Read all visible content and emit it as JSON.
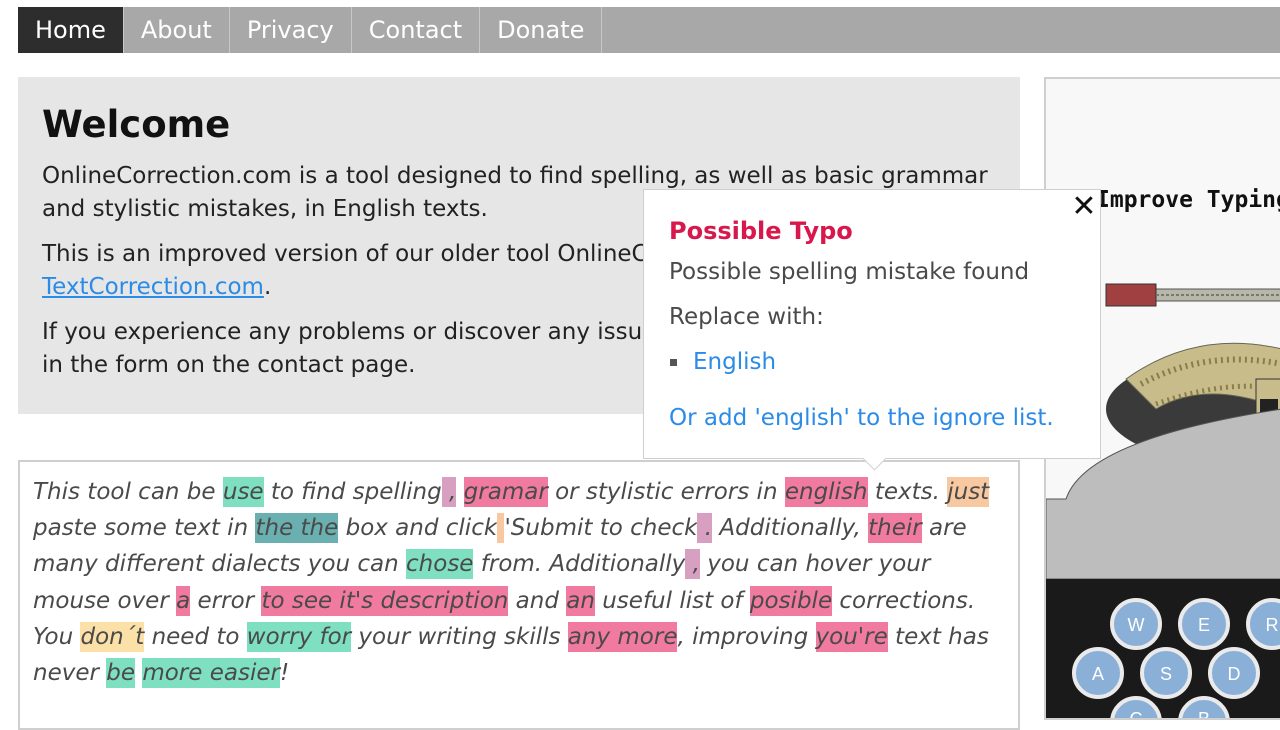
{
  "nav": {
    "items": [
      {
        "label": "Home",
        "active": true
      },
      {
        "label": "About"
      },
      {
        "label": "Privacy"
      },
      {
        "label": "Contact"
      },
      {
        "label": "Donate"
      }
    ]
  },
  "welcome": {
    "title": "Welcome",
    "p1": "OnlineCorrection.com is a tool designed to find spelling, as well as basic grammar and stylistic mistakes, in English texts.",
    "p2_before": "This is an improved version of our older tool OnlineCorrection, still available at ",
    "p2_link": "TextCorrection.com",
    "p2_after": ".",
    "p3": "If you experience any problems or discover any issues please let us know by filling in the form on the contact page."
  },
  "editor": {
    "segments": [
      {
        "t": "This tool can be "
      },
      {
        "t": "use",
        "c": "green"
      },
      {
        "t": " to find spelling"
      },
      {
        "t": " ,",
        "c": "mauve"
      },
      {
        "t": " "
      },
      {
        "t": "gramar",
        "c": "pink"
      },
      {
        "t": " or stylistic errors in "
      },
      {
        "t": "english",
        "c": "pink"
      },
      {
        "t": " texts. "
      },
      {
        "t": "just",
        "c": "orange"
      },
      {
        "t": " paste some text in "
      },
      {
        "t": "the the",
        "c": "teal"
      },
      {
        "t": " box and click"
      },
      {
        "t": " ",
        "c": "orange"
      },
      {
        "t": "'Submit to check"
      },
      {
        "t": " .",
        "c": "mauve"
      },
      {
        "t": " Additionally, "
      },
      {
        "t": "their",
        "c": "pink"
      },
      {
        "t": " are many different dialects you can "
      },
      {
        "t": "chose",
        "c": "green"
      },
      {
        "t": " from. Additionally"
      },
      {
        "t": " ,",
        "c": "mauve"
      },
      {
        "t": " you can hover your mouse over "
      },
      {
        "t": "a",
        "c": "pink"
      },
      {
        "t": " error "
      },
      {
        "t": "to see it's description",
        "c": "pink"
      },
      {
        "t": " and "
      },
      {
        "t": "an",
        "c": "pink"
      },
      {
        "t": " useful list of "
      },
      {
        "t": "posible",
        "c": "pink"
      },
      {
        "t": " corrections. You "
      },
      {
        "t": "don´t",
        "c": "yellow"
      },
      {
        "t": " need to "
      },
      {
        "t": "worry for",
        "c": "green"
      },
      {
        "t": " your writing skills "
      },
      {
        "t": "any more",
        "c": "pink"
      },
      {
        "t": ", improving "
      },
      {
        "t": "you're",
        "c": "pink"
      },
      {
        "t": " text has never "
      },
      {
        "t": "be",
        "c": "green"
      },
      {
        "t": " "
      },
      {
        "t": "more easier",
        "c": "green"
      },
      {
        "t": "!"
      }
    ]
  },
  "side": {
    "title": "Improve Typing",
    "keys_row1": [
      "W",
      "E",
      "R"
    ],
    "keys_row2": [
      "A",
      "S",
      "D"
    ],
    "keys_row3": [
      "C",
      "B"
    ]
  },
  "popup": {
    "title": "Possible Typo",
    "message": "Possible spelling mistake found",
    "replace_label": "Replace with:",
    "suggestions": [
      "English"
    ],
    "ignore_link": "Or add 'english' to the ignore list."
  },
  "colors": {
    "nav_bg": "#a8a8a8",
    "nav_active": "#2d2d2d",
    "panel_bg": "#e6e6e6",
    "link": "#2a8be8",
    "popup_title": "#d8184c",
    "mark_green": "#7ee0c0",
    "mark_pink": "#f07aa0",
    "mark_orange": "#f8c8a0",
    "mark_yellow": "#fbe0a8",
    "mark_teal": "#6ab0b0",
    "mark_mauve": "#d8a0c0"
  },
  "icons": [
    "close-icon",
    "typewriter-illustration"
  ]
}
